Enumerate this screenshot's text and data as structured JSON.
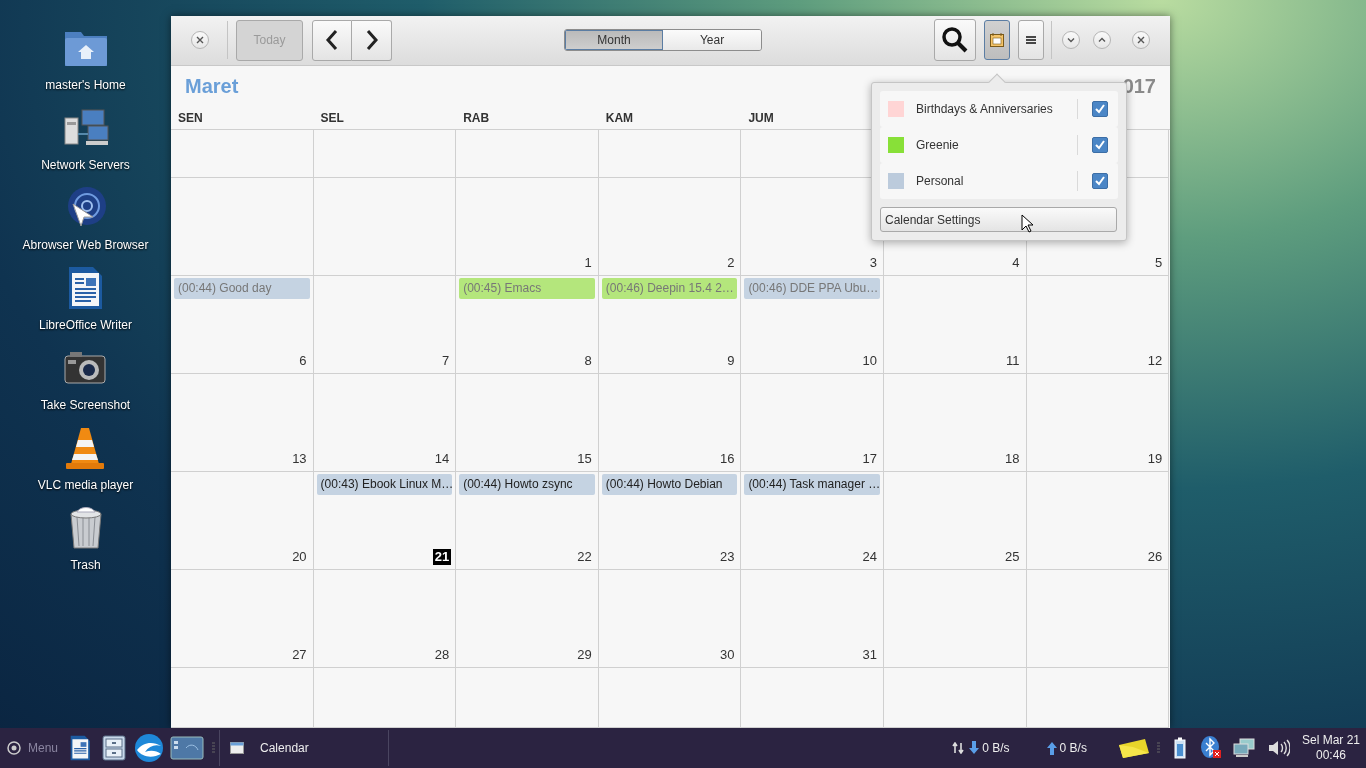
{
  "desktop_icons": [
    {
      "kind": "home",
      "label": "master's Home"
    },
    {
      "kind": "network",
      "label": "Network Servers"
    },
    {
      "kind": "browser",
      "label": "Abrowser Web Browser"
    },
    {
      "kind": "writer",
      "label": "LibreOffice Writer"
    },
    {
      "kind": "camera",
      "label": "Take Screenshot"
    },
    {
      "kind": "cone",
      "label": "VLC media player"
    },
    {
      "kind": "trash",
      "label": "Trash"
    }
  ],
  "calendar_window": {
    "toolbar": {
      "today": {
        "label": "Today",
        "disabled": true
      },
      "view_tabs": [
        {
          "label": "Month",
          "selected": true
        },
        {
          "label": "Year",
          "selected": false
        }
      ],
      "calendars_toggle": {
        "on": true
      }
    },
    "month": "Maret",
    "year": "017",
    "weekdays": [
      "SEN",
      "SEL",
      "RAB",
      "KAM",
      "JUM"
    ],
    "weeks": [
      {
        "days": [
          {
            "kind": "blank"
          },
          {
            "kind": "blank"
          },
          {
            "kind": "blank"
          },
          {
            "kind": "blank"
          },
          {
            "kind": "blank"
          },
          {
            "kind": "covered"
          },
          {
            "kind": "blank"
          }
        ]
      },
      {
        "days": [
          {
            "kind": "blank"
          },
          {
            "kind": "blank"
          },
          {
            "date": "1",
            "today": false
          },
          {
            "date": "2",
            "today": false
          },
          {
            "date": "3",
            "today": false
          },
          {
            "date": "4",
            "today": false
          },
          {
            "date": "5",
            "today": false
          }
        ]
      },
      {
        "days": [
          {
            "date": "6",
            "today": false,
            "events": [
              {
                "label": "(00:44) Good day",
                "color": "#c5d3e2",
                "past": true
              }
            ]
          },
          {
            "date": "7",
            "today": false
          },
          {
            "date": "8",
            "today": false,
            "events": [
              {
                "label": "(00:45) Emacs",
                "color": "#b4e67c",
                "past": true
              }
            ]
          },
          {
            "date": "9",
            "today": false,
            "events": [
              {
                "label": "(00:46) Deepin 15.4 2…",
                "color": "#b4e67c",
                "past": true
              }
            ]
          },
          {
            "date": "10",
            "today": false,
            "events": [
              {
                "label": "(00:46) DDE PPA Ubu…",
                "color": "#c5d3e2",
                "past": true
              }
            ]
          },
          {
            "date": "11",
            "today": false
          },
          {
            "date": "12",
            "today": false
          }
        ]
      },
      {
        "days": [
          {
            "date": "13",
            "today": false
          },
          {
            "date": "14",
            "today": false
          },
          {
            "date": "15",
            "today": false
          },
          {
            "date": "16",
            "today": false
          },
          {
            "date": "17",
            "today": false
          },
          {
            "date": "18",
            "today": false
          },
          {
            "date": "19",
            "today": false
          }
        ]
      },
      {
        "days": [
          {
            "date": "20",
            "today": false
          },
          {
            "date": "21",
            "today": true,
            "events": [
              {
                "label": "(00:43) Ebook Linux M…",
                "color": "#c5d3e2",
                "past": false
              }
            ]
          },
          {
            "date": "22",
            "today": false,
            "events": [
              {
                "label": "(00:44) Howto zsync",
                "color": "#c5d3e2",
                "past": false
              }
            ]
          },
          {
            "date": "23",
            "today": false,
            "events": [
              {
                "label": "(00:44) Howto Debian",
                "color": "#c5d3e2",
                "past": false
              }
            ]
          },
          {
            "date": "24",
            "today": false,
            "events": [
              {
                "label": "(00:44) Task manager …",
                "color": "#c5d3e2",
                "past": false
              }
            ]
          },
          {
            "date": "25",
            "today": false
          },
          {
            "date": "26",
            "today": false
          }
        ]
      },
      {
        "days": [
          {
            "date": "27",
            "today": false
          },
          {
            "date": "28",
            "today": false
          },
          {
            "date": "29",
            "today": false
          },
          {
            "date": "30",
            "today": false
          },
          {
            "date": "31",
            "today": false
          },
          {
            "kind": "blank"
          },
          {
            "kind": "blank"
          }
        ]
      },
      {
        "days": [
          {
            "kind": "blank"
          },
          {
            "kind": "blank"
          },
          {
            "kind": "blank"
          },
          {
            "kind": "blank"
          },
          {
            "kind": "blank"
          },
          {
            "kind": "blank"
          },
          {
            "kind": "blank"
          }
        ]
      }
    ]
  },
  "calendar_menu": {
    "calendars": [
      {
        "name": "Birthdays & Anniversaries",
        "color": "#ffd5d5",
        "checked": true
      },
      {
        "name": "Greenie",
        "color": "#88e038",
        "checked": true
      },
      {
        "name": "Personal",
        "color": "#bccbdc",
        "checked": true
      }
    ],
    "settings_button": "Calendar Settings"
  },
  "taskbar": {
    "menu": "Menu",
    "launchers": [
      {
        "kind": "writer"
      },
      {
        "kind": "cabinet"
      },
      {
        "kind": "browser"
      },
      {
        "kind": "desktop"
      }
    ],
    "tasks": [
      {
        "label": "Calendar"
      }
    ],
    "download": "0 B/s",
    "upload": "0 B/s",
    "clock": {
      "date": "Sel Mar 21",
      "time": "00:46"
    }
  }
}
